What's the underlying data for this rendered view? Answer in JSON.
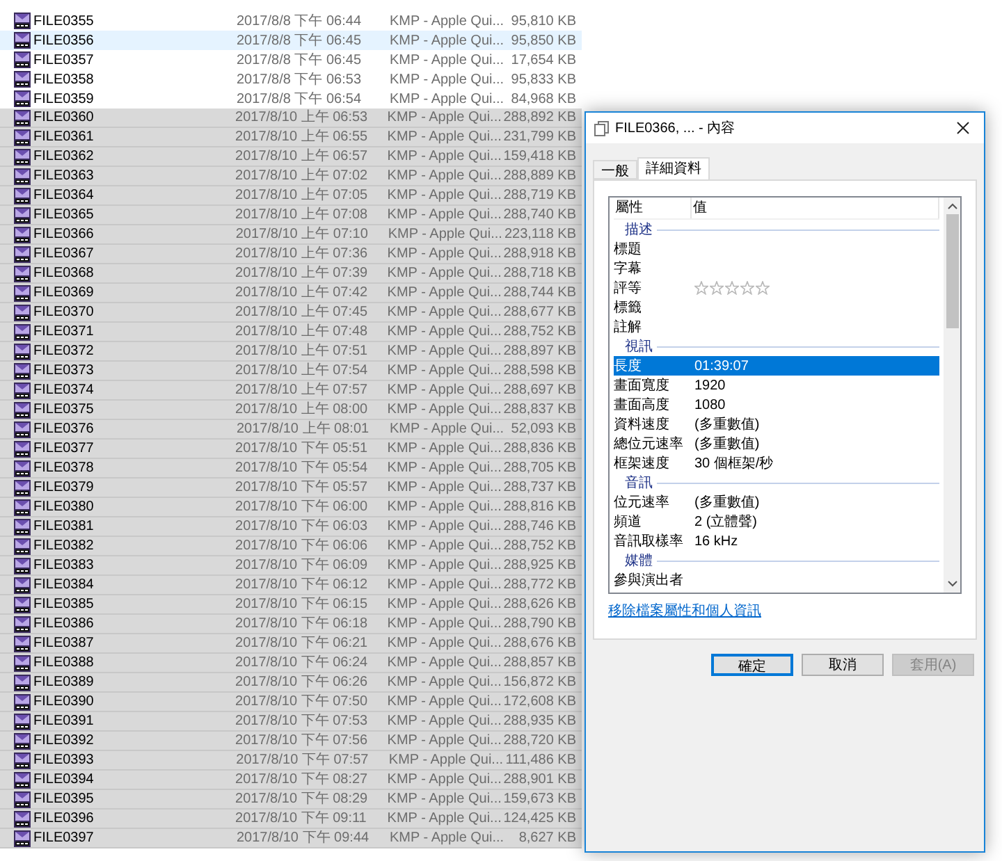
{
  "files": [
    {
      "name": "FILE0355",
      "date": "2017/8/8 下午 06:44",
      "type": "KMP - Apple Qui...",
      "size": "95,810 KB",
      "selected": false,
      "hovered": false
    },
    {
      "name": "FILE0356",
      "date": "2017/8/8 下午 06:45",
      "type": "KMP - Apple Qui...",
      "size": "95,850 KB",
      "selected": false,
      "hovered": true
    },
    {
      "name": "FILE0357",
      "date": "2017/8/8 下午 06:45",
      "type": "KMP - Apple Qui...",
      "size": "17,654 KB",
      "selected": false,
      "hovered": false
    },
    {
      "name": "FILE0358",
      "date": "2017/8/8 下午 06:53",
      "type": "KMP - Apple Qui...",
      "size": "95,833 KB",
      "selected": false,
      "hovered": false
    },
    {
      "name": "FILE0359",
      "date": "2017/8/8 下午 06:54",
      "type": "KMP - Apple Qui...",
      "size": "84,968 KB",
      "selected": false,
      "hovered": false
    },
    {
      "name": "FILE0360",
      "date": "2017/8/10 上午 06:53",
      "type": "KMP - Apple Qui...",
      "size": "288,892 KB",
      "selected": true,
      "hovered": false
    },
    {
      "name": "FILE0361",
      "date": "2017/8/10 上午 06:55",
      "type": "KMP - Apple Qui...",
      "size": "231,799 KB",
      "selected": true,
      "hovered": false
    },
    {
      "name": "FILE0362",
      "date": "2017/8/10 上午 06:57",
      "type": "KMP - Apple Qui...",
      "size": "159,418 KB",
      "selected": true,
      "hovered": false
    },
    {
      "name": "FILE0363",
      "date": "2017/8/10 上午 07:02",
      "type": "KMP - Apple Qui...",
      "size": "288,889 KB",
      "selected": true,
      "hovered": false
    },
    {
      "name": "FILE0364",
      "date": "2017/8/10 上午 07:05",
      "type": "KMP - Apple Qui...",
      "size": "288,719 KB",
      "selected": true,
      "hovered": false
    },
    {
      "name": "FILE0365",
      "date": "2017/8/10 上午 07:08",
      "type": "KMP - Apple Qui...",
      "size": "288,740 KB",
      "selected": true,
      "hovered": false
    },
    {
      "name": "FILE0366",
      "date": "2017/8/10 上午 07:10",
      "type": "KMP - Apple Qui...",
      "size": "223,118 KB",
      "selected": true,
      "hovered": false
    },
    {
      "name": "FILE0367",
      "date": "2017/8/10 上午 07:36",
      "type": "KMP - Apple Qui...",
      "size": "288,918 KB",
      "selected": true,
      "hovered": false
    },
    {
      "name": "FILE0368",
      "date": "2017/8/10 上午 07:39",
      "type": "KMP - Apple Qui...",
      "size": "288,718 KB",
      "selected": true,
      "hovered": false
    },
    {
      "name": "FILE0369",
      "date": "2017/8/10 上午 07:42",
      "type": "KMP - Apple Qui...",
      "size": "288,744 KB",
      "selected": true,
      "hovered": false
    },
    {
      "name": "FILE0370",
      "date": "2017/8/10 上午 07:45",
      "type": "KMP - Apple Qui...",
      "size": "288,677 KB",
      "selected": true,
      "hovered": false
    },
    {
      "name": "FILE0371",
      "date": "2017/8/10 上午 07:48",
      "type": "KMP - Apple Qui...",
      "size": "288,752 KB",
      "selected": true,
      "hovered": false
    },
    {
      "name": "FILE0372",
      "date": "2017/8/10 上午 07:51",
      "type": "KMP - Apple Qui...",
      "size": "288,897 KB",
      "selected": true,
      "hovered": false
    },
    {
      "name": "FILE0373",
      "date": "2017/8/10 上午 07:54",
      "type": "KMP - Apple Qui...",
      "size": "288,598 KB",
      "selected": true,
      "hovered": false
    },
    {
      "name": "FILE0374",
      "date": "2017/8/10 上午 07:57",
      "type": "KMP - Apple Qui...",
      "size": "288,697 KB",
      "selected": true,
      "hovered": false
    },
    {
      "name": "FILE0375",
      "date": "2017/8/10 上午 08:00",
      "type": "KMP - Apple Qui...",
      "size": "288,837 KB",
      "selected": true,
      "hovered": false
    },
    {
      "name": "FILE0376",
      "date": "2017/8/10 上午 08:01",
      "type": "KMP - Apple Qui...",
      "size": "52,093 KB",
      "selected": true,
      "hovered": false
    },
    {
      "name": "FILE0377",
      "date": "2017/8/10 下午 05:51",
      "type": "KMP - Apple Qui...",
      "size": "288,836 KB",
      "selected": true,
      "hovered": false
    },
    {
      "name": "FILE0378",
      "date": "2017/8/10 下午 05:54",
      "type": "KMP - Apple Qui...",
      "size": "288,705 KB",
      "selected": true,
      "hovered": false
    },
    {
      "name": "FILE0379",
      "date": "2017/8/10 下午 05:57",
      "type": "KMP - Apple Qui...",
      "size": "288,737 KB",
      "selected": true,
      "hovered": false
    },
    {
      "name": "FILE0380",
      "date": "2017/8/10 下午 06:00",
      "type": "KMP - Apple Qui...",
      "size": "288,816 KB",
      "selected": true,
      "hovered": false
    },
    {
      "name": "FILE0381",
      "date": "2017/8/10 下午 06:03",
      "type": "KMP - Apple Qui...",
      "size": "288,746 KB",
      "selected": true,
      "hovered": false
    },
    {
      "name": "FILE0382",
      "date": "2017/8/10 下午 06:06",
      "type": "KMP - Apple Qui...",
      "size": "288,752 KB",
      "selected": true,
      "hovered": false
    },
    {
      "name": "FILE0383",
      "date": "2017/8/10 下午 06:09",
      "type": "KMP - Apple Qui...",
      "size": "288,925 KB",
      "selected": true,
      "hovered": false
    },
    {
      "name": "FILE0384",
      "date": "2017/8/10 下午 06:12",
      "type": "KMP - Apple Qui...",
      "size": "288,772 KB",
      "selected": true,
      "hovered": false
    },
    {
      "name": "FILE0385",
      "date": "2017/8/10 下午 06:15",
      "type": "KMP - Apple Qui...",
      "size": "288,626 KB",
      "selected": true,
      "hovered": false
    },
    {
      "name": "FILE0386",
      "date": "2017/8/10 下午 06:18",
      "type": "KMP - Apple Qui...",
      "size": "288,790 KB",
      "selected": true,
      "hovered": false
    },
    {
      "name": "FILE0387",
      "date": "2017/8/10 下午 06:21",
      "type": "KMP - Apple Qui...",
      "size": "288,676 KB",
      "selected": true,
      "hovered": false
    },
    {
      "name": "FILE0388",
      "date": "2017/8/10 下午 06:24",
      "type": "KMP - Apple Qui...",
      "size": "288,857 KB",
      "selected": true,
      "hovered": false
    },
    {
      "name": "FILE0389",
      "date": "2017/8/10 下午 06:26",
      "type": "KMP - Apple Qui...",
      "size": "156,872 KB",
      "selected": true,
      "hovered": false
    },
    {
      "name": "FILE0390",
      "date": "2017/8/10 下午 07:50",
      "type": "KMP - Apple Qui...",
      "size": "172,608 KB",
      "selected": true,
      "hovered": false
    },
    {
      "name": "FILE0391",
      "date": "2017/8/10 下午 07:53",
      "type": "KMP - Apple Qui...",
      "size": "288,935 KB",
      "selected": true,
      "hovered": false
    },
    {
      "name": "FILE0392",
      "date": "2017/8/10 下午 07:56",
      "type": "KMP - Apple Qui...",
      "size": "288,720 KB",
      "selected": true,
      "hovered": false
    },
    {
      "name": "FILE0393",
      "date": "2017/8/10 下午 07:57",
      "type": "KMP - Apple Qui...",
      "size": "111,486 KB",
      "selected": true,
      "hovered": false
    },
    {
      "name": "FILE0394",
      "date": "2017/8/10 下午 08:27",
      "type": "KMP - Apple Qui...",
      "size": "288,901 KB",
      "selected": true,
      "hovered": false
    },
    {
      "name": "FILE0395",
      "date": "2017/8/10 下午 08:29",
      "type": "KMP - Apple Qui...",
      "size": "159,673 KB",
      "selected": true,
      "hovered": false
    },
    {
      "name": "FILE0396",
      "date": "2017/8/10 下午 09:11",
      "type": "KMP - Apple Qui...",
      "size": "124,425 KB",
      "selected": true,
      "hovered": false
    },
    {
      "name": "FILE0397",
      "date": "2017/8/10 下午 09:44",
      "type": "KMP - Apple Qui...",
      "size": "8,627 KB",
      "selected": true,
      "hovered": false
    }
  ],
  "dialog": {
    "title": "FILE0366, ... - 內容",
    "tabs": [
      {
        "label": "一般",
        "selected": false
      },
      {
        "label": "詳細資料",
        "selected": true
      }
    ],
    "columns": [
      "屬性",
      "值"
    ],
    "properties": [
      {
        "kind": "section",
        "label": "描述"
      },
      {
        "kind": "row",
        "label": "標題",
        "selected": false
      },
      {
        "kind": "row",
        "label": "字幕",
        "selected": false
      },
      {
        "kind": "rating",
        "label": "評等",
        "stars": 0,
        "selected": false
      },
      {
        "kind": "row",
        "label": "標籤",
        "selected": false
      },
      {
        "kind": "row",
        "label": "註解",
        "selected": false
      },
      {
        "kind": "section",
        "label": "視訊"
      },
      {
        "kind": "row",
        "label": "長度",
        "value": "01:39:07",
        "selected": true
      },
      {
        "kind": "row",
        "label": "畫面寬度",
        "value": "1920",
        "selected": false
      },
      {
        "kind": "row",
        "label": "畫面高度",
        "value": "1080",
        "selected": false
      },
      {
        "kind": "row",
        "label": "資料速度",
        "value": "(多重數值)",
        "selected": false
      },
      {
        "kind": "row",
        "label": "總位元速率",
        "value": "(多重數值)",
        "selected": false
      },
      {
        "kind": "row",
        "label": "框架速度",
        "value": "30 個框架/秒",
        "selected": false
      },
      {
        "kind": "section",
        "label": "音訊"
      },
      {
        "kind": "row",
        "label": "位元速率",
        "value": "(多重數值)",
        "selected": false
      },
      {
        "kind": "row",
        "label": "頻道",
        "value": "2 (立體聲)",
        "selected": false
      },
      {
        "kind": "row",
        "label": "音訊取樣率",
        "value": "16 kHz",
        "selected": false
      },
      {
        "kind": "section",
        "label": "媒體"
      },
      {
        "kind": "row",
        "label": "參與演出者",
        "selected": false
      }
    ],
    "link": "移除檔案屬性和個人資訊",
    "buttons": [
      {
        "label": "確定",
        "default": true,
        "disabled": false
      },
      {
        "label": "取消",
        "default": false,
        "disabled": false
      },
      {
        "label": "套用(A)",
        "default": false,
        "disabled": true
      }
    ]
  }
}
